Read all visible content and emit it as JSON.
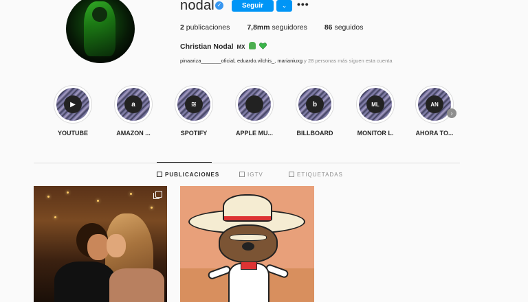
{
  "profile": {
    "username": "nodal",
    "follow_label": "Seguir",
    "more_label": "•••",
    "dropdown_glyph": "⌄",
    "verified_glyph": "✓",
    "stats": {
      "posts_count": "2",
      "posts_label": "publicaciones",
      "followers_count": "7,8mm",
      "followers_label": "seguidores",
      "following_count": "86",
      "following_label": "seguidos"
    },
    "full_name": "Christian Nodal",
    "country": "MX",
    "followed_by_names": "pinaariza_______oficial, eduardo.vilchis_, marianiuxg",
    "followed_by_rest": " y 28 personas más siguen esta cuenta"
  },
  "highlights": [
    {
      "label": "YOUTUBE",
      "logo": "▶",
      "icon": "youtube-icon"
    },
    {
      "label": "AMAZON ...",
      "logo": "a",
      "icon": "amazon-icon"
    },
    {
      "label": "SPOTIFY",
      "logo": "≋",
      "icon": "spotify-icon"
    },
    {
      "label": "APPLE MU...",
      "logo": "",
      "icon": "apple-icon"
    },
    {
      "label": "BILLBOARD",
      "logo": "b",
      "icon": "billboard-icon"
    },
    {
      "label": "MONITOR L.",
      "logo": "ML",
      "icon": "monitor-latino-icon"
    },
    {
      "label": "AHORA TO...",
      "logo": "AN",
      "icon": "ahora-icon"
    }
  ],
  "highlights_next_glyph": "›",
  "tabs": [
    {
      "label": "PUBLICACIONES",
      "active": true
    },
    {
      "label": "IGTV",
      "active": false
    },
    {
      "label": "ETIQUETADAS",
      "active": false
    }
  ],
  "colors": {
    "accent": "#0095f6",
    "text": "#262626",
    "muted": "#8e8e8e",
    "background": "#fafafa"
  }
}
